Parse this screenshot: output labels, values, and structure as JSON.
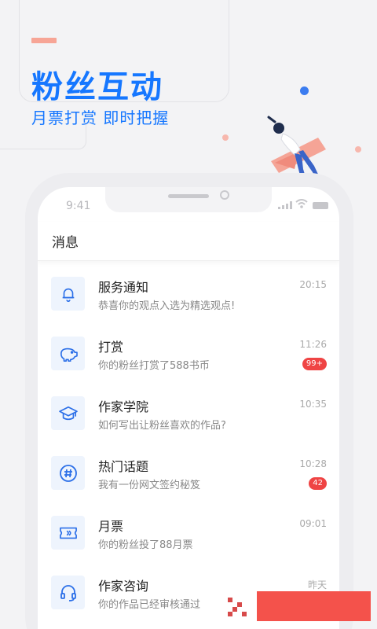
{
  "hero": {
    "title": "粉丝互动",
    "subtitle": "月票打赏 即时把握"
  },
  "status_bar": {
    "time": "9:41"
  },
  "header": {
    "title": "消息"
  },
  "messages": [
    {
      "title": "服务通知",
      "desc": "恭喜你的观点入选为精选观点!",
      "time": "20:15",
      "badge": "",
      "icon": "bell-icon"
    },
    {
      "title": "打赏",
      "desc": "你的粉丝打赏了588书币",
      "time": "11:26",
      "badge": "99+",
      "icon": "piggy-bank-icon"
    },
    {
      "title": "作家学院",
      "desc": "如何写出让粉丝喜欢的作品?",
      "time": "10:35",
      "badge": "",
      "icon": "graduation-cap-icon"
    },
    {
      "title": "热门话题",
      "desc": "我有一份网文签约秘笈",
      "time": "10:28",
      "badge": "42",
      "icon": "hashtag-icon"
    },
    {
      "title": "月票",
      "desc": "你的粉丝投了88月票",
      "time": "09:01",
      "badge": "",
      "icon": "ticket-icon"
    },
    {
      "title": "作家咨询",
      "desc": "你的作品已经审核通过",
      "time": "昨天",
      "badge": "",
      "icon": "headset-icon"
    }
  ],
  "colors": {
    "brand": "#1677ff",
    "badge": "#ef4444",
    "accent": "#f7a596"
  }
}
